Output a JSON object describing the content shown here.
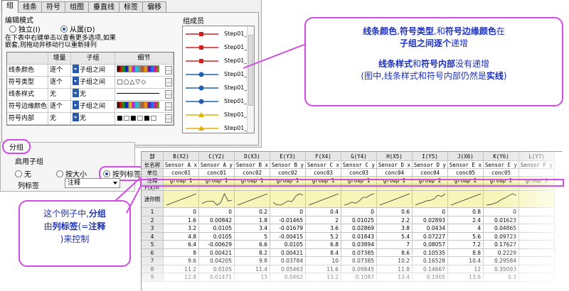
{
  "tabs": [
    "组",
    "线条",
    "符号",
    "组图",
    "垂直线",
    "标签",
    "偏移"
  ],
  "edit_mode": {
    "label": "编辑模式",
    "options": [
      "独立(I)",
      "从属(D)"
    ],
    "selected": "从属(D)"
  },
  "instructions": "在下表中右键单击以查看更多选项,如果嵌套,则拖动并移动行以重新排列",
  "increment_table": {
    "headers": [
      "",
      "增量",
      "子组",
      "细节"
    ],
    "rows": [
      {
        "name": "线条颜色",
        "increment": "逐个",
        "subgroup": "子组之间",
        "detail": "color-strip"
      },
      {
        "name": "符号类型",
        "increment": "逐个",
        "subgroup": "子组之间",
        "detail": "□○△▽◇"
      },
      {
        "name": "线条样式",
        "increment": "无",
        "subgroup": "无",
        "detail": "line-solid"
      },
      {
        "name": "符号边缘颜色",
        "increment": "逐个",
        "subgroup": "子组之间",
        "detail": "color-strip"
      },
      {
        "name": "符号内部",
        "increment": "无",
        "subgroup": "无",
        "detail": "■□■□■□"
      }
    ]
  },
  "members": {
    "title": "组成员",
    "items": [
      {
        "label": "Step01_",
        "color": "#d12020",
        "symbol": "square"
      },
      {
        "label": "Step01_",
        "color": "#d12020",
        "symbol": "square"
      },
      {
        "label": "Step01_",
        "color": "#d12020",
        "symbol": "square"
      },
      {
        "label": "Step01_",
        "color": "#2060b0",
        "symbol": "circle"
      },
      {
        "label": "Step01_",
        "color": "#2060b0",
        "symbol": "circle"
      },
      {
        "label": "Step01_",
        "color": "#2060b0",
        "symbol": "circle"
      },
      {
        "label": "Step01_",
        "color": "#e0b000",
        "symbol": "triangle"
      },
      {
        "label": "Step01_",
        "color": "#e0b000",
        "symbol": "triangle"
      }
    ]
  },
  "grouping": {
    "legend": "分组",
    "enable_label": "启用子组",
    "options": [
      "无",
      "按大小",
      "按列标签"
    ],
    "selected": "按列标签",
    "column_label_label": "列标签",
    "column_label_value": "注释"
  },
  "sheet": {
    "corner": "部",
    "columns": [
      "B(X2)",
      "C(Y2)",
      "D(X3)",
      "E(Y3)",
      "F(X4)",
      "G(Y4)",
      "H(X5)",
      "I(Y5)",
      "J(X6)",
      "K(Y6)",
      "L(Y7)"
    ],
    "row_labels": {
      "long_name": "长名称",
      "units": "单位",
      "comments": "注释",
      "fx": "F(x)=",
      "sparklines": "迷你图"
    },
    "long_names": [
      "Sensor A x",
      "Sensor A y",
      "Sensor B x",
      "Sensor B y",
      "Sensor C x",
      "Sensor C y",
      "Sensor D x",
      "Sensor D y",
      "Sensor E x",
      "Sensor E y",
      "Sensor F y"
    ],
    "units": [
      "conc01",
      "conc01",
      "conc02",
      "conc02",
      "conc03",
      "conc03",
      "conc04",
      "conc04",
      "conc05",
      "conc05",
      ""
    ],
    "comments": [
      "group 1",
      "group 1",
      "group 1",
      "group 1",
      "group 1",
      "group 1",
      "group 2",
      "group 2",
      "group 2",
      "group 2",
      "group 3"
    ],
    "rows": [
      {
        "n": "1",
        "v": [
          "0",
          "0",
          "0.2",
          "0",
          "0.4",
          "0",
          "0.6",
          "0",
          "0.8",
          "0",
          ""
        ]
      },
      {
        "n": "2",
        "v": [
          "1.6",
          "0.00842",
          "1.8",
          "-0.01465",
          "2",
          "0.01025",
          "2.2",
          "0.02893",
          "2.4",
          "0.01623",
          ""
        ]
      },
      {
        "n": "3",
        "v": [
          "3.2",
          "0.0105",
          "3.4",
          "-0.01679",
          "3.6",
          "0.02869",
          "3.8",
          "0.0434",
          "4",
          "0.04865",
          ""
        ]
      },
      {
        "n": "4",
        "v": [
          "4.8",
          "0.0105",
          "5",
          "-0.00415",
          "5.2",
          "0.01843",
          "5.4",
          "0.07227",
          "5.6",
          "0.09723",
          ""
        ]
      },
      {
        "n": "5",
        "v": [
          "6.4",
          "-0.00629",
          "6.6",
          "0.0105",
          "6.8",
          "0.03894",
          "7",
          "0.08057",
          "7.2",
          "0.17627",
          ""
        ]
      },
      {
        "n": "6",
        "v": [
          "8",
          "0.00421",
          "8.2",
          "0.00421",
          "8.4",
          "0.07385",
          "8.6",
          "0.10535",
          "8.8",
          "0.2229",
          ""
        ]
      },
      {
        "n": "7",
        "v": [
          "9.6",
          "0.04205",
          "9.8",
          "0.03784",
          "10",
          "0.07385",
          "10.2",
          "0.16528",
          "10.4",
          "0.29584",
          ""
        ]
      },
      {
        "n": "8",
        "v": [
          "11.2",
          "0.0105",
          "11.4",
          "0.05463",
          "11.6",
          "0.09845",
          "11.8",
          "0.14667",
          "12",
          "0.35093",
          ""
        ]
      },
      {
        "n": "9",
        "v": [
          "12.8",
          "0.01471",
          "13",
          "0.0462",
          "13.2",
          "0.1087",
          "13.4",
          "0.1905",
          "13.6",
          "0.3",
          ""
        ]
      }
    ]
  },
  "callout_top": {
    "line1_parts": [
      "线条颜色",
      ",",
      "符号类型",
      ",和",
      "符号边缘颜色",
      "在"
    ],
    "line2_parts": [
      "子组之间逐个",
      "递增"
    ],
    "line3_parts": [
      "线条样式",
      "和",
      "符号内部",
      "没有递增"
    ],
    "line4_parts": [
      "(图中,线条样式和符号内部仍然是",
      "实线",
      ")"
    ]
  },
  "callout_left": {
    "parts": [
      "这个例子中,",
      "分组",
      "由",
      "列标签",
      "(=",
      "注释",
      ")来控制"
    ]
  },
  "colors": {
    "accent": "#d24be4",
    "callout_text": "#1a2fc0",
    "highlight_row": "#f7f5b8"
  }
}
